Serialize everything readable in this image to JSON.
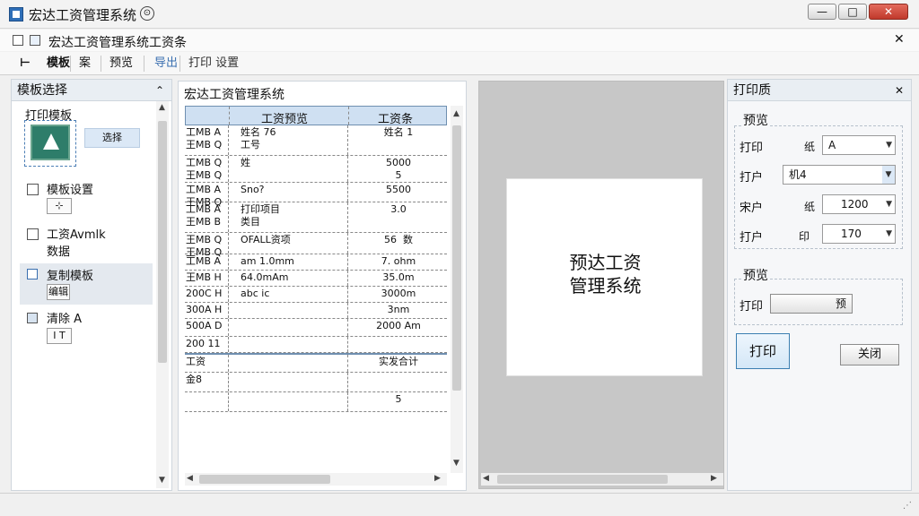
{
  "window": {
    "title": "宏达工资管理系统",
    "title_mark": "⊙",
    "minimize": "—",
    "maximize": "□",
    "close": "✕"
  },
  "document": {
    "title": "宏达工资管理系统工资条",
    "close": "✕"
  },
  "toolbar": {
    "items": [
      "模板",
      "案",
      "预览",
      "导出",
      "打印 设置"
    ]
  },
  "left_panel": {
    "title": "模板选择",
    "items": [
      {
        "label": "打印模板",
        "button": "选择"
      },
      {
        "label": "模板设置",
        "button": ""
      },
      {
        "label": "工资Avmlk",
        "sub": "数据"
      },
      {
        "label": "复制模板",
        "button": "编辑"
      },
      {
        "label": "清除 A",
        "button": "I T"
      }
    ]
  },
  "sheet": {
    "tab": "宏达工资管理系统",
    "headers": [
      "工资预览",
      "工资条"
    ],
    "rows": [
      {
        "a": "工MB A\n王MB Q",
        "b": "姓名 76\n工号",
        "c": "姓名 1"
      },
      {
        "a": "工MB Q\n王MB Q",
        "b": "姓",
        "c": "5000\n5"
      },
      {
        "a": "工MB A\n王MB Q",
        "b": "Sno?",
        "c": "5500"
      },
      {
        "a": "工MB A\n王MB B",
        "b": "打印项目\n类目",
        "c": "3.0"
      },
      {
        "a": "王MB Q\n王MB Q",
        "b": "OFALL资项",
        "c": "56  数"
      },
      {
        "a": "工MB A",
        "b": "am 1.0mm",
        "c": "7. ohm"
      },
      {
        "a": "王MB H",
        "b": "64.0mAm",
        "c": "35.0m"
      },
      {
        "a": "200C H",
        "b": "abc ic",
        "c": "3000m"
      },
      {
        "a": "300A H",
        "b": "",
        "c": "3nm"
      },
      {
        "a": "500A D",
        "b": "",
        "c": "2000 Am"
      },
      {
        "a": "200 11",
        "b": "",
        "c": ""
      },
      {
        "a": "工资",
        "b": "",
        "c": "实发合计"
      },
      {
        "a": "金8",
        "b": "",
        "c": ""
      },
      {
        "a": "",
        "b": "",
        "c": "5"
      }
    ]
  },
  "preview": {
    "line1": "预达工资",
    "line2": "管理系统"
  },
  "print_panel": {
    "title": "打印质",
    "close": "✕",
    "preview_group": "预览",
    "fields": [
      {
        "label": "打印",
        "unit": "纸",
        "value": "A"
      },
      {
        "label": "打户",
        "unit": "",
        "value": "机4"
      },
      {
        "label": "宋户",
        "unit": "纸",
        "value": "1200"
      },
      {
        "label": "打户",
        "unit": "印",
        "value": "170"
      }
    ],
    "options_group": "预览",
    "option_label": "打印",
    "option_button": "预",
    "print_button": "打印",
    "cancel_button": "关闭"
  }
}
